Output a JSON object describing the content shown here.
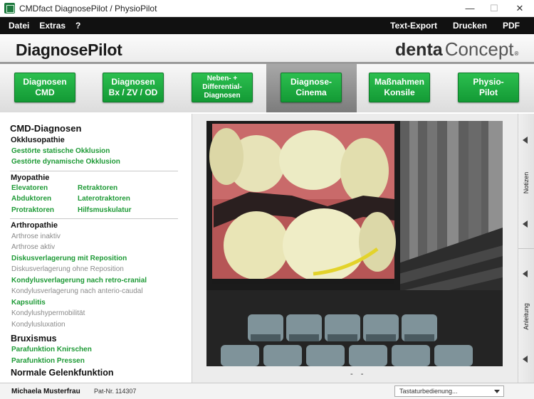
{
  "window": {
    "title": "CMDfact DiagnosePilot / PhysioPilot",
    "min_glyph": "—",
    "max_glyph": "☐",
    "close_glyph": "✕"
  },
  "menu": {
    "left": [
      "Datei",
      "Extras",
      "?"
    ],
    "right": [
      "Text-Export",
      "Drucken",
      "PDF"
    ]
  },
  "header": {
    "brand": "DiagnosePilot",
    "logo_left": "denta",
    "logo_right": "Concept",
    "logo_reg": "®"
  },
  "nav": {
    "active_index": 3,
    "buttons": [
      {
        "label": "Diagnosen\nCMD"
      },
      {
        "label": "Diagnosen\nBx / ZV / OD"
      },
      {
        "label": "Neben- +\nDifferential-\nDiagnosen"
      },
      {
        "label": "Diagnose-\nCinema"
      },
      {
        "label": "Maßnahmen\nKonsile"
      },
      {
        "label": "Physio-\nPilot"
      }
    ]
  },
  "left_panel": {
    "title": "CMD-Diagnosen",
    "okklusopathie": {
      "heading": "Okklusopathie",
      "items": [
        "Gestörte statische Okklusion",
        "Gestörte dynamische Okklusion"
      ]
    },
    "myopathie": {
      "heading": "Myopathie",
      "col1": [
        "Elevatoren",
        "Abduktoren",
        "Protraktoren"
      ],
      "col2": [
        "Retraktoren",
        "Laterotraktoren",
        "Hilfsmuskulatur"
      ]
    },
    "arthropathie": {
      "heading": "Arthropathie",
      "items": [
        {
          "label": "Arthrose inaktiv",
          "active": false
        },
        {
          "label": "Arthrose aktiv",
          "active": false
        },
        {
          "label": "Diskusverlagerung mit Reposition",
          "active": true
        },
        {
          "label": "Diskusverlagerung ohne Reposition",
          "active": false
        },
        {
          "label": "Kondylusverlagerung nach retro-cranial",
          "active": true
        },
        {
          "label": "Kondylusverlagerung nach anterio-caudal",
          "active": false
        },
        {
          "label": "Kapsulitis",
          "active": true
        },
        {
          "label": "Kondylushypermobilität",
          "active": false
        },
        {
          "label": "Kondylusluxation",
          "active": false
        }
      ]
    },
    "bruxismus": {
      "heading": "Bruxismus",
      "items": [
        "Parafunktion Knirschen",
        "Parafunktion Pressen"
      ]
    },
    "normal": {
      "heading": "Normale Gelenkfunktion"
    }
  },
  "center": {
    "pager": "- -"
  },
  "right_bar": {
    "label_top": "Notizen",
    "label_bottom": "Anleitung"
  },
  "status": {
    "patient": "Michaela Musterfrau",
    "patnr_label": "Pat-Nr.",
    "patnr": "114307",
    "select_value": "Tastaturbedienung..."
  },
  "colors": {
    "accent_green": "#1e9a36",
    "menu_bg": "#111111",
    "inactive_gray": "#8a8a8a"
  }
}
